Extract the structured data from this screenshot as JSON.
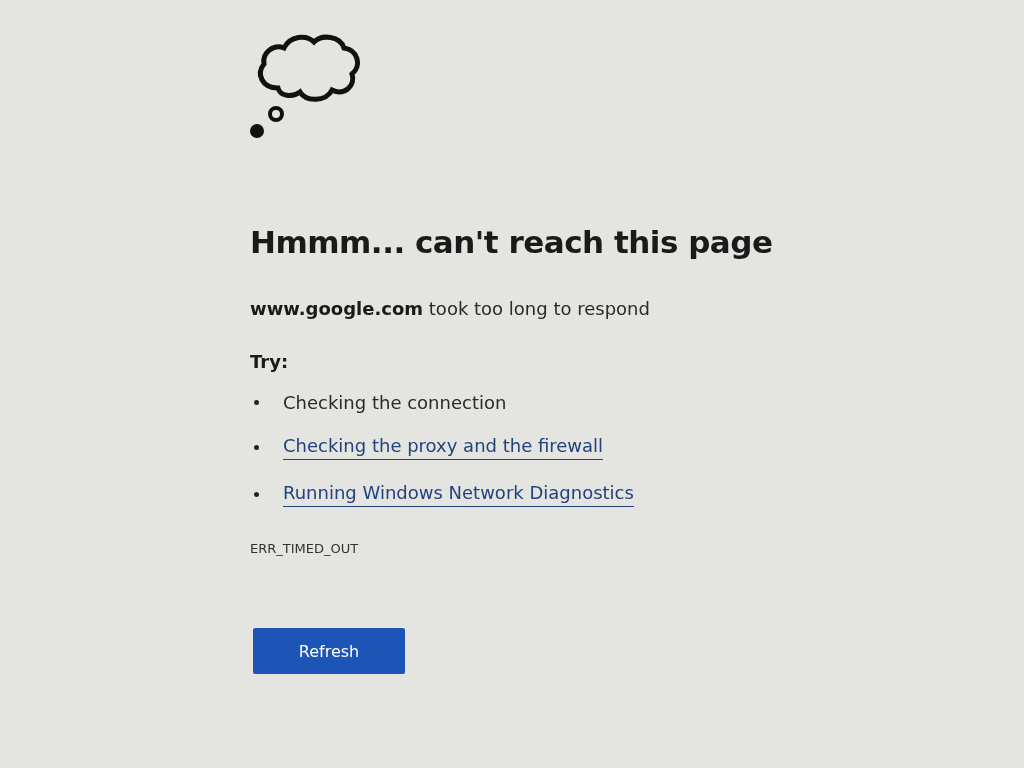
{
  "heading": "Hmmm... can't reach this page",
  "message": "**www.google.com** took too long to respond",
  "try_label": "Try:",
  "suggestions": [
    {
      "kind": "text",
      "label": "Checking the connection"
    },
    {
      "kind": "link",
      "label": "Checking the proxy and the firewall"
    },
    {
      "kind": "link",
      "label": "Running Windows Network Diagnostics"
    }
  ],
  "error_code": "ERR_TIMED_OUT",
  "button": "Refresh"
}
